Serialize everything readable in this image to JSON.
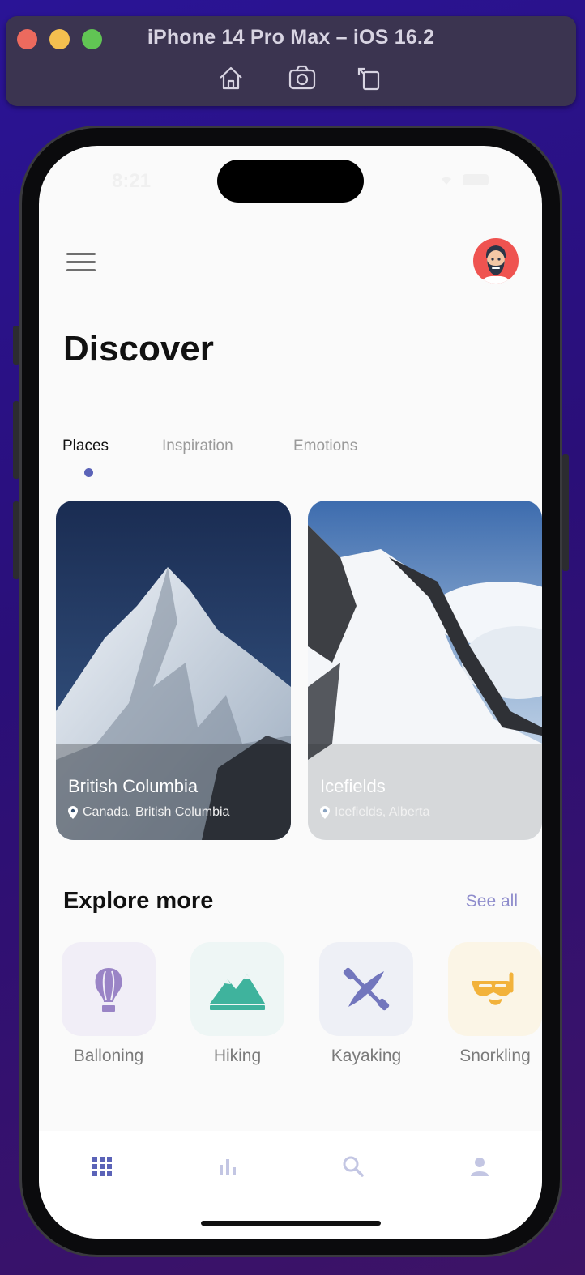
{
  "window": {
    "title": "iPhone 14 Pro Max – iOS 16.2",
    "toolbar_icons": [
      "home-icon",
      "screenshot-icon",
      "rotate-icon"
    ]
  },
  "status_bar": {
    "time": "8:21"
  },
  "header": {
    "menu_icon": "hamburger-icon",
    "avatar": "user-avatar"
  },
  "page": {
    "title": "Discover"
  },
  "tabs": [
    {
      "label": "Places",
      "active": true
    },
    {
      "label": "Inspiration",
      "active": false
    },
    {
      "label": "Emotions",
      "active": false
    }
  ],
  "places": [
    {
      "name": "British Columbia",
      "location": "Canada, British Columbia"
    },
    {
      "name": "Icefields",
      "location": "Icefields, Alberta"
    }
  ],
  "explore": {
    "title": "Explore more",
    "see_all": "See all",
    "categories": [
      {
        "label": "Balloning",
        "icon": "hot-air-balloon-icon",
        "color": "#9a84c6",
        "bg": "#f1eef7"
      },
      {
        "label": "Hiking",
        "icon": "mountain-icon",
        "color": "#3fb39d",
        "bg": "#eef6f5"
      },
      {
        "label": "Kayaking",
        "icon": "kayak-icon",
        "color": "#7276bd",
        "bg": "#eef0f6"
      },
      {
        "label": "Snorkling",
        "icon": "snorkel-mask-icon",
        "color": "#f2b23b",
        "bg": "#fbf5e6"
      }
    ]
  },
  "bottom_nav": [
    {
      "icon": "grid-icon",
      "active": true
    },
    {
      "icon": "bar-chart-icon",
      "active": false
    },
    {
      "icon": "search-icon",
      "active": false
    },
    {
      "icon": "profile-icon",
      "active": false
    }
  ],
  "colors": {
    "accent": "#5b63b8",
    "see_all": "#8e8ccc"
  }
}
